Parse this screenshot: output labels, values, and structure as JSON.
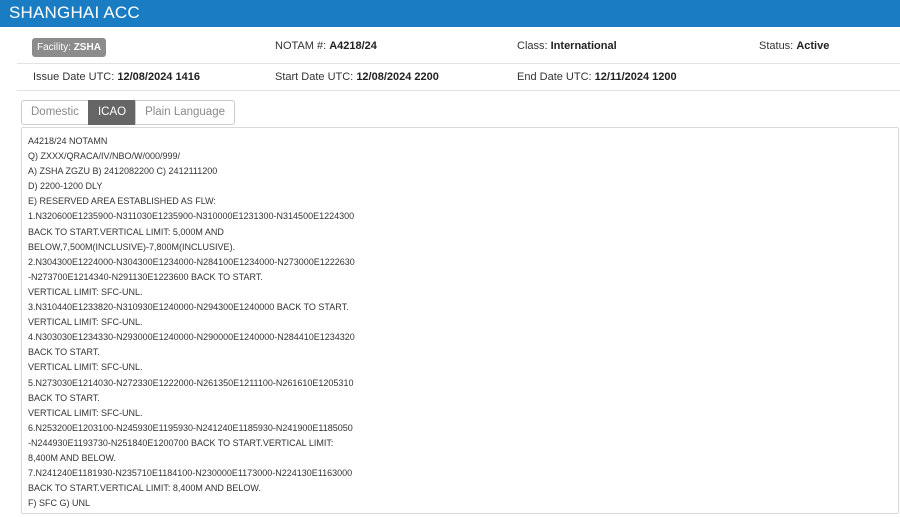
{
  "header": {
    "title": "SHANGHAI ACC"
  },
  "info": {
    "facility_label": "Facility:",
    "facility_value": "ZSHA",
    "notam_label": "NOTAM #:",
    "notam_value": "A4218/24",
    "class_label": "Class:",
    "class_value": "International",
    "status_label": "Status:",
    "status_value": "Active",
    "issue_label": "Issue Date UTC:",
    "issue_value": "12/08/2024 1416",
    "start_label": "Start Date UTC:",
    "start_value": "12/08/2024 2200",
    "end_label": "End Date UTC:",
    "end_value": "12/11/2024 1200"
  },
  "tabs": [
    {
      "label": "Domestic",
      "active": false
    },
    {
      "label": "ICAO",
      "active": true
    },
    {
      "label": "Plain Language",
      "active": false
    }
  ],
  "notam_lines": [
    "A4218/24 NOTAMN",
    "Q) ZXXX/QRACA/IV/NBO/W/000/999/",
    "A) ZSHA ZGZU B) 2412082200 C) 2412111200",
    "D) 2200-1200 DLY",
    "E) RESERVED AREA ESTABLISHED AS FLW:",
    "1.N320600E1235900-N311030E1235900-N310000E1231300-N314500E1224300",
    "BACK TO START.VERTICAL LIMIT: 5,000M AND",
    "BELOW,7,500M(INCLUSIVE)-7,800M(INCLUSIVE).",
    "2.N304300E1224000-N304300E1234000-N284100E1234000-N273000E1222630",
    "-N273700E1214340-N291130E1223600 BACK TO START.",
    "VERTICAL LIMIT: SFC-UNL.",
    "3.N310440E1233820-N310930E1240000-N294300E1240000 BACK TO START.",
    "VERTICAL LIMIT: SFC-UNL.",
    "4.N303030E1234330-N293000E1240000-N290000E1240000-N284410E1234320",
    "BACK TO START.",
    "VERTICAL LIMIT: SFC-UNL.",
    "5.N273030E1214030-N272330E1222000-N261350E1211100-N261610E1205310",
    "BACK TO START.",
    "VERTICAL LIMIT: SFC-UNL.",
    "6.N253200E1203100-N245930E1195930-N241240E1185930-N241900E1185050",
    "-N244930E1193730-N251840E1200700 BACK TO START.VERTICAL LIMIT:",
    "8,400M AND BELOW.",
    "7.N241240E1181930-N235710E1184100-N230000E1173000-N224130E1163000",
    "BACK TO START.VERTICAL LIMIT: 8,400M AND BELOW.",
    "F) SFC G) UNL"
  ]
}
